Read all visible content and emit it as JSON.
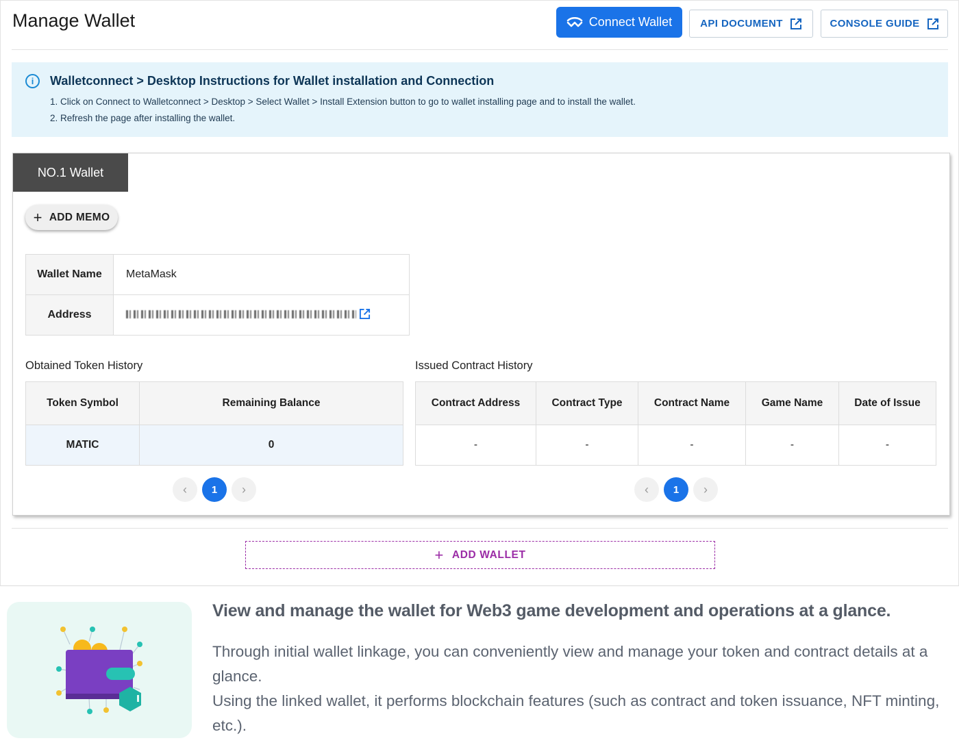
{
  "header": {
    "title": "Manage Wallet",
    "connect_label": "Connect Wallet",
    "api_label": "API DOCUMENT",
    "console_label": "CONSOLE GUIDE"
  },
  "info": {
    "title": "Walletconnect > Desktop Instructions for Wallet installation and Connection",
    "lines": [
      "1. Click on Connect to Walletconnect > Desktop > Select Wallet > Install Extension button to go to wallet installing page and to install the wallet.",
      "2. Refresh the page after installing the wallet."
    ]
  },
  "wallet": {
    "tab_label": "NO.1 Wallet",
    "add_memo_label": "ADD MEMO",
    "name_key": "Wallet Name",
    "name_value": "MetaMask",
    "address_key": "Address"
  },
  "token_history": {
    "label": "Obtained Token History",
    "columns": [
      "Token Symbol",
      "Remaining Balance"
    ],
    "rows": [
      [
        "MATIC",
        "0"
      ]
    ],
    "page": "1"
  },
  "contract_history": {
    "label": "Issued Contract History",
    "columns": [
      "Contract Address",
      "Contract Type",
      "Contract Name",
      "Game Name",
      "Date of Issue"
    ],
    "rows": [
      [
        "-",
        "-",
        "-",
        "-",
        "-"
      ]
    ],
    "page": "1"
  },
  "add_wallet_label": "ADD WALLET",
  "promo": {
    "heading": "View and manage the wallet for Web3 game development and operations at a glance.",
    "line1": "Through initial wallet linkage, you can conveniently view and manage your token and contract details at a glance.",
    "line2": "Using the linked wallet, it performs blockchain features (such as contract and token issuance, NFT minting, etc.)."
  },
  "colors": {
    "primary": "#1a73e8",
    "add_wallet": "#9b2ca6",
    "info_bg": "#e5f4fb",
    "tab_bg": "#4a4a4a"
  },
  "icons": [
    "walletconnect-icon",
    "external-link-icon",
    "info-icon",
    "plus-icon",
    "chevron-left-icon",
    "chevron-right-icon",
    "wallet-illustration"
  ]
}
